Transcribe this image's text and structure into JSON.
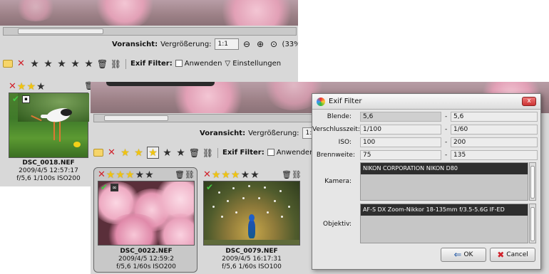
{
  "back_window": {
    "preview_label": "Voransicht:",
    "zoom_label": "Vergrößerung:",
    "zoom_value": "1:1",
    "zoom_percent": "(33%)",
    "exif_filter_label": "Exif Filter:",
    "apply_label": "Anwenden",
    "settings_label": "Einstellungen",
    "thumb": {
      "filename": "DSC_0018.NEF",
      "date": "2009/4/5 12:57:17",
      "exposure": "f/5,6 1/100s ISO200"
    }
  },
  "front_window": {
    "preview_label": "Voransicht:",
    "zoom_label": "Vergrößerung:",
    "zoom_value": "1:1",
    "exif_filter_label": "Exif Filter:",
    "apply_label": "Anwenden",
    "thumbs": [
      {
        "filename": "DSC_0022.NEF",
        "date": "2009/4/5 12:59:2",
        "exposure": "f/5,6 1/60s ISO200"
      },
      {
        "filename": "DSC_0079.NEF",
        "date": "2009/4/5 16:17:31",
        "exposure": "f/5,6 1/60s ISO100"
      }
    ]
  },
  "dialog": {
    "title": "Exif Filter",
    "close_label": "x",
    "fields": [
      {
        "label": "Blende:",
        "from": "5,6",
        "to": "5,6"
      },
      {
        "label": "Verschlusszeit:",
        "from": "1/100",
        "to": "1/60"
      },
      {
        "label": "ISO:",
        "from": "100",
        "to": "200"
      },
      {
        "label": "Brennweite:",
        "from": "75",
        "to": "135"
      }
    ],
    "range_separator": "-",
    "camera_label": "Kamera:",
    "camera_value": "NIKON CORPORATION NIKON D80",
    "lens_label": "Objektiv:",
    "lens_value": "AF-S DX Zoom-Nikkor 18-135mm f/3.5-5.6G IF-ED",
    "ok_label": "OK",
    "cancel_label": "Cancel"
  }
}
